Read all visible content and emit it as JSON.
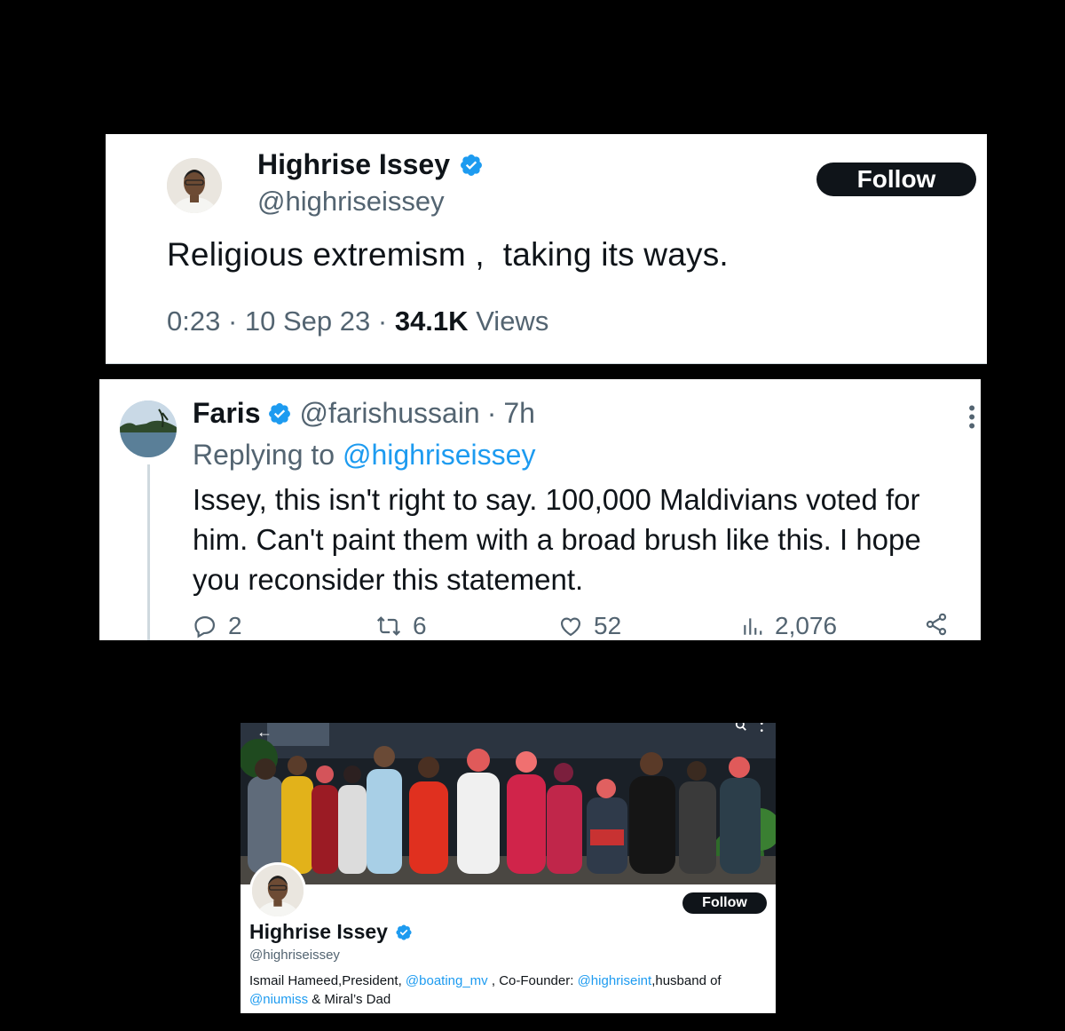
{
  "tweet1": {
    "display_name": "Highrise Issey",
    "handle": "@highriseissey",
    "follow_label": "Follow",
    "text": "Religious extremism ,  taking its ways.",
    "time": "0:23",
    "date": "10 Sep 23",
    "views_count": "34.1K",
    "views_label": "Views",
    "sep": " · "
  },
  "tweet2": {
    "display_name": "Faris",
    "handle": "@farishussain",
    "age": "7h",
    "replying_prefix": "Replying to ",
    "replying_to": "@highriseissey",
    "body": "Issey, this isn't right to say. 100,000 Maldivians voted for him. Can't paint them with a broad brush like this. I hope you reconsider this statement.",
    "replies": "2",
    "retweets": "6",
    "likes": "52",
    "views": "2,076"
  },
  "profile": {
    "display_name": "Highrise Issey",
    "handle": "@highriseissey",
    "follow_label": "Follow",
    "bio_part1": "Ismail Hameed,President, ",
    "bio_link1": "@boating_mv",
    "bio_part2": " , Co-Founder: ",
    "bio_link2": "@highriseint",
    "bio_part3": ",husband of ",
    "bio_link3": "@niumiss",
    "bio_part4": " & Miral’s Dad",
    "back_glyph": "←"
  },
  "colors": {
    "accent": "#1d9bf0",
    "verified": "#1d9bf0",
    "text": "#0f1419",
    "muted": "#536471",
    "follow_bg": "#0f1419"
  }
}
